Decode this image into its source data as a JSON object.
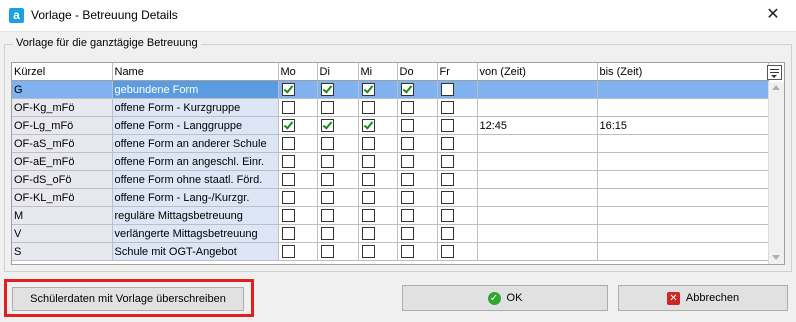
{
  "window": {
    "title": "Vorlage - Betreuung Details",
    "app_icon_letter": "a"
  },
  "group": {
    "legend": "Vorlage für die ganztägige Betreuung"
  },
  "columns": [
    "Kürzel",
    "Name",
    "Mo",
    "Di",
    "Mi",
    "Do",
    "Fr",
    "von (Zeit)",
    "bis (Zeit)"
  ],
  "rows": [
    {
      "kuerzel": "G",
      "name": "gebundene Form",
      "mo": true,
      "di": true,
      "mi": true,
      "do": true,
      "fr": false,
      "von": "",
      "bis": ""
    },
    {
      "kuerzel": "OF-Kg_mFö",
      "name": "offene Form - Kurzgruppe",
      "mo": false,
      "di": false,
      "mi": false,
      "do": false,
      "fr": false,
      "von": "",
      "bis": ""
    },
    {
      "kuerzel": "OF-Lg_mFö",
      "name": "offene Form - Langgruppe",
      "mo": true,
      "di": true,
      "mi": true,
      "do": false,
      "fr": false,
      "von": "12:45",
      "bis": "16:15"
    },
    {
      "kuerzel": "OF-aS_mFö",
      "name": "offene Form an anderer Schule",
      "mo": false,
      "di": false,
      "mi": false,
      "do": false,
      "fr": false,
      "von": "",
      "bis": ""
    },
    {
      "kuerzel": "OF-aE_mFö",
      "name": "offene Form an angeschl. Einr.",
      "mo": false,
      "di": false,
      "mi": false,
      "do": false,
      "fr": false,
      "von": "",
      "bis": ""
    },
    {
      "kuerzel": "OF-dS_oFö",
      "name": "offene Form ohne staatl. Förd.",
      "mo": false,
      "di": false,
      "mi": false,
      "do": false,
      "fr": false,
      "von": "",
      "bis": ""
    },
    {
      "kuerzel": "OF-KL_mFö",
      "name": "offene Form - Lang-/Kurzgr.",
      "mo": false,
      "di": false,
      "mi": false,
      "do": false,
      "fr": false,
      "von": "",
      "bis": ""
    },
    {
      "kuerzel": "M",
      "name": "reguläre Mittagsbetreuung",
      "mo": false,
      "di": false,
      "mi": false,
      "do": false,
      "fr": false,
      "von": "",
      "bis": ""
    },
    {
      "kuerzel": "V",
      "name": "verlängerte Mittagsbetreuung",
      "mo": false,
      "di": false,
      "mi": false,
      "do": false,
      "fr": false,
      "von": "",
      "bis": ""
    },
    {
      "kuerzel": "S",
      "name": "Schule mit OGT-Angebot",
      "mo": false,
      "di": false,
      "mi": false,
      "do": false,
      "fr": false,
      "von": "",
      "bis": ""
    }
  ],
  "buttons": {
    "overwrite": "Schülerdaten mit Vorlage überschreiben",
    "ok": "OK",
    "cancel": "Abbrechen"
  },
  "icons": {
    "close": "close-icon",
    "ok": "check-circle-icon",
    "cancel": "x-square-icon",
    "column_menu": "column-chooser-icon"
  }
}
